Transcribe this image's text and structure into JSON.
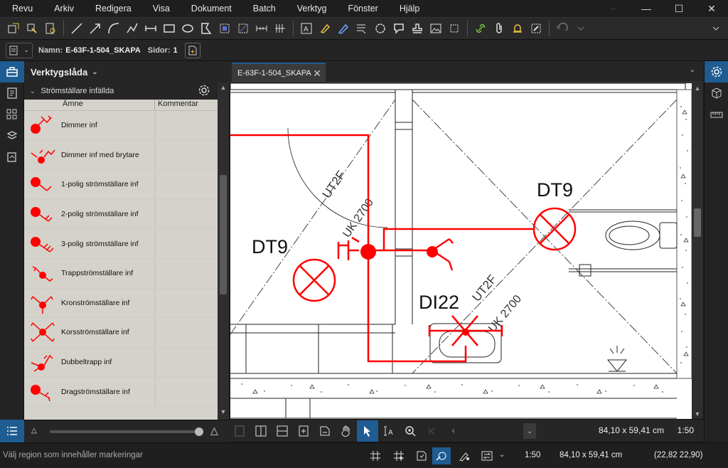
{
  "menu": [
    "Revu",
    "Arkiv",
    "Redigera",
    "Visa",
    "Dokument",
    "Batch",
    "Verktyg",
    "Fönster",
    "Hjälp"
  ],
  "window_controls": {
    "more": "···",
    "minimize": "—",
    "maximize": "☐",
    "close": "✕"
  },
  "propbar": {
    "name_label": "Namn:",
    "name_value": "E-63F-1-504_SKAPA",
    "pages_label": "Sidor:",
    "pages_value": "1"
  },
  "toolchest": {
    "title": "Verktygslåda",
    "group": "Strömställare infällda",
    "col_subject": "Ämne",
    "col_comment": "Kommentar",
    "items": [
      "Dimmer inf",
      "Dimmer inf med brytare",
      "1-polig strömställare inf",
      "2-polig strömställare inf",
      "3-polig strömställare inf",
      "Trappströmställare inf",
      "Kronströmställare inf",
      "Korsströmställare inf",
      "Dubbeltrapp inf",
      "Dragströmställare inf"
    ]
  },
  "doc_tab": "E-63F-1-504_SKAPA",
  "drawing": {
    "label_dt9_left": "DT9",
    "label_dt9_right": "DT9",
    "label_di22": "DI22",
    "text_ut2f_1": "UT2F",
    "text_uk_1": "UK 2700",
    "text_ut2f_2": "UT2F",
    "text_uk_2": "UK 2700"
  },
  "navbar": {
    "dims": "84,10 x 59,41 cm",
    "scale": "1:50"
  },
  "status": {
    "message": "Välj region som innehåller markeringar",
    "scale": "1:50",
    "dims": "84,10 x 59,41 cm",
    "coords": "(22,82  22,90)"
  },
  "colors": {
    "accent": "#1e5c92",
    "markup": "#ff0000",
    "panel_bg": "#d4d2cb"
  }
}
